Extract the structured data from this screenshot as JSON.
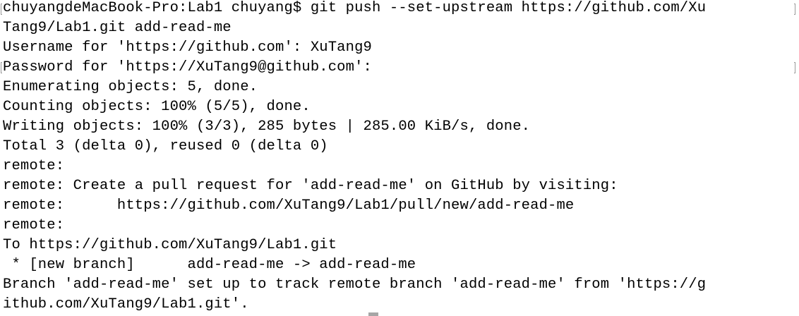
{
  "terminal": {
    "lines": [
      "chuyangdeMacBook-Pro:Lab1 chuyang$ git push --set-upstream https://github.com/Xu",
      "Tang9/Lab1.git add-read-me",
      "Username for 'https://github.com': XuTang9",
      "Password for 'https://XuTang9@github.com':",
      "Enumerating objects: 5, done.",
      "Counting objects: 100% (5/5), done.",
      "Writing objects: 100% (3/3), 285 bytes | 285.00 KiB/s, done.",
      "Total 3 (delta 0), reused 0 (delta 0)",
      "remote:",
      "remote: Create a pull request for 'add-read-me' on GitHub by visiting:",
      "remote:      https://github.com/XuTang9/Lab1/pull/new/add-read-me",
      "remote:",
      "To https://github.com/XuTang9/Lab1.git",
      " * [new branch]      add-read-me -> add-read-me",
      "Branch 'add-read-me' set up to track remote branch 'add-read-me' from 'https://g",
      "ithub.com/XuTang9/Lab1.git'."
    ]
  }
}
